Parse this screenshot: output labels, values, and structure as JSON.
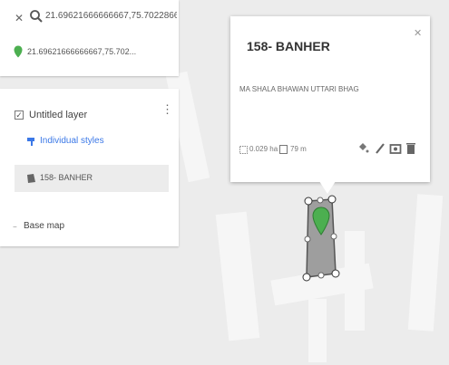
{
  "search": {
    "query": "21.69621666666667,75.7022866...",
    "result": "21.69621666666667,75.702..."
  },
  "layer": {
    "name": "Untitled layer",
    "style_link": "Individual styles",
    "feature_label": "158- BANHER",
    "basemap_label": "Base map"
  },
  "popup": {
    "title": "158- BANHER",
    "description": "MA SHALA BHAWAN UTTARI BHAG",
    "area": "0.029 ha",
    "perimeter": "79 m"
  },
  "icons": {
    "close": "close-icon",
    "search": "search-icon",
    "pin": "map-pin-icon",
    "style": "paint-bucket-icon",
    "polygon": "polygon-icon",
    "more": "more-vert-icon",
    "edit_style": "paint-bucket-icon",
    "edit": "pencil-icon",
    "photo": "camera-icon",
    "delete": "trash-icon"
  },
  "colors": {
    "accent": "#3b78e7",
    "pin": "#4caf50",
    "polygon_fill": "#9e9e9e",
    "panel": "#ffffff",
    "map_bg": "#ececec"
  },
  "glyphs": {
    "close": "✕",
    "check": "✓",
    "more": "⋮",
    "collapse": "−"
  }
}
